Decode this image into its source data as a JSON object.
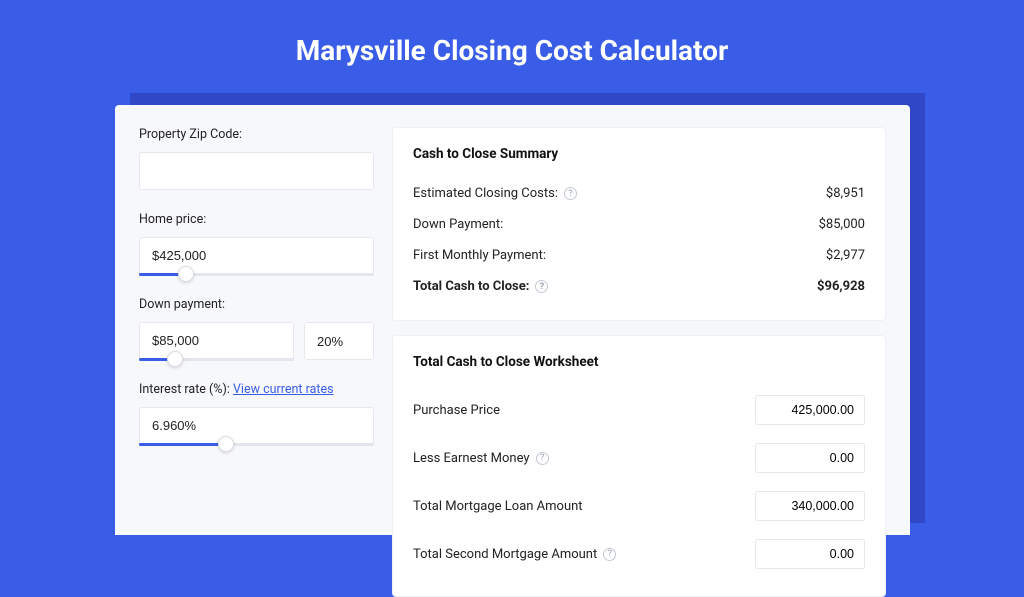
{
  "page": {
    "title": "Marysville Closing Cost Calculator"
  },
  "form": {
    "zip": {
      "label": "Property Zip Code:",
      "value": ""
    },
    "price": {
      "label": "Home price:",
      "value": "$425,000",
      "fill": "20%"
    },
    "down": {
      "label": "Down payment:",
      "value": "$85,000",
      "pct": "20%",
      "fill": "23%"
    },
    "rate": {
      "label": "Interest rate (%):",
      "link": "View current rates",
      "value": "6.960%",
      "fill": "37%"
    }
  },
  "summary": {
    "title": "Cash to Close Summary",
    "rows": [
      {
        "label": "Estimated Closing Costs:",
        "help": true,
        "value": "$8,951"
      },
      {
        "label": "Down Payment:",
        "help": false,
        "value": "$85,000"
      },
      {
        "label": "First Monthly Payment:",
        "help": false,
        "value": "$2,977"
      }
    ],
    "total": {
      "label": "Total Cash to Close:",
      "help": true,
      "value": "$96,928"
    }
  },
  "worksheet": {
    "title": "Total Cash to Close Worksheet",
    "rows": [
      {
        "label": "Purchase Price",
        "help": false,
        "value": "425,000.00"
      },
      {
        "label": "Less Earnest Money",
        "help": true,
        "value": "0.00"
      },
      {
        "label": "Total Mortgage Loan Amount",
        "help": false,
        "value": "340,000.00"
      },
      {
        "label": "Total Second Mortgage Amount",
        "help": true,
        "value": "0.00"
      }
    ]
  }
}
